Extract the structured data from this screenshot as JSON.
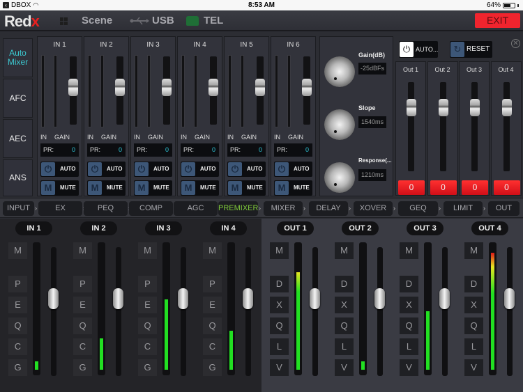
{
  "status_bar": {
    "carrier": "DBOX",
    "time": "8:53 AM",
    "battery": "64%",
    "battery_level": 0.64
  },
  "top_bar": {
    "logo_main": "Red",
    "logo_accent": "x",
    "scene": "Scene",
    "usb": "USB",
    "tel": "TEL",
    "exit": "EXIT"
  },
  "modes": [
    {
      "label": "Auto Mixer",
      "active": true
    },
    {
      "label": "AFC",
      "active": false
    },
    {
      "label": "AEC",
      "active": false
    },
    {
      "label": "ANS",
      "active": false
    }
  ],
  "input_strips": [
    {
      "title": "IN 1",
      "in_label": "IN",
      "gain_label": "GAIN",
      "pr_label": "PR:",
      "pr_value": "0",
      "auto": "AUTO",
      "mute": "MUTE",
      "gain_pos": 0.55
    },
    {
      "title": "IN 2",
      "in_label": "IN",
      "gain_label": "GAIN",
      "pr_label": "PR:",
      "pr_value": "0",
      "auto": "AUTO",
      "mute": "MUTE",
      "gain_pos": 0.55
    },
    {
      "title": "IN 3",
      "in_label": "IN",
      "gain_label": "GAIN",
      "pr_label": "PR:",
      "pr_value": "0",
      "auto": "AUTO",
      "mute": "MUTE",
      "gain_pos": 0.55
    },
    {
      "title": "IN 4",
      "in_label": "IN",
      "gain_label": "GAIN",
      "pr_label": "PR:",
      "pr_value": "0",
      "auto": "AUTO",
      "mute": "MUTE",
      "gain_pos": 0.55
    },
    {
      "title": "IN 5",
      "in_label": "IN",
      "gain_label": "GAIN",
      "pr_label": "PR:",
      "pr_value": "0",
      "auto": "AUTO",
      "mute": "MUTE",
      "gain_pos": 0.55
    },
    {
      "title": "IN 6",
      "in_label": "IN",
      "gain_label": "GAIN",
      "pr_label": "PR:",
      "pr_value": "0",
      "auto": "AUTO",
      "mute": "MUTE",
      "gain_pos": 0.55
    }
  ],
  "mute_glyph": "M",
  "auto_mixer": {
    "knobs": [
      {
        "label": "Gain(dB)",
        "value": "-25dBFs"
      },
      {
        "label": "Slope",
        "value": "1540ms"
      },
      {
        "label": "Response(...",
        "value": "1210ms"
      }
    ],
    "auto_button": "AUTO...",
    "reset_button": "RESET"
  },
  "outputs_top": [
    {
      "title": "Out 1",
      "value": "0",
      "fader_pos": 0.72
    },
    {
      "title": "Out 2",
      "value": "0",
      "fader_pos": 0.72
    },
    {
      "title": "Out 3",
      "value": "0",
      "fader_pos": 0.72
    },
    {
      "title": "Out 4",
      "value": "0",
      "fader_pos": 0.72
    }
  ],
  "chain": [
    {
      "label": "INPUT",
      "active": false
    },
    {
      "label": "EX",
      "active": false
    },
    {
      "label": "PEQ",
      "active": false
    },
    {
      "label": "COMP",
      "active": false
    },
    {
      "label": "AGC",
      "active": false
    },
    {
      "label": "PREMIXER",
      "active": true
    },
    {
      "label": "MIXER",
      "active": false
    },
    {
      "label": "DELAY",
      "active": false
    },
    {
      "label": "XOVER",
      "active": false
    },
    {
      "label": "GEQ",
      "active": false
    },
    {
      "label": "LIMIT",
      "active": false
    },
    {
      "label": "OUT",
      "active": false
    }
  ],
  "bottom_inputs": [
    {
      "title": "IN 1",
      "buttons": [
        "M",
        "P",
        "E",
        "Q",
        "C",
        "G"
      ],
      "level": 0.07,
      "fader_pos": 0.6
    },
    {
      "title": "IN 2",
      "buttons": [
        "M",
        "P",
        "E",
        "Q",
        "C",
        "G"
      ],
      "level": 0.26,
      "fader_pos": 0.6
    },
    {
      "title": "IN 3",
      "buttons": [
        "M",
        "P",
        "E",
        "Q",
        "C",
        "G"
      ],
      "level": 0.58,
      "fader_pos": 0.6
    },
    {
      "title": "IN 4",
      "buttons": [
        "M",
        "P",
        "E",
        "Q",
        "C",
        "G"
      ],
      "level": 0.32,
      "fader_pos": 0.6
    }
  ],
  "bottom_outputs": [
    {
      "title": "OUT 1",
      "buttons": [
        "M",
        "D",
        "X",
        "Q",
        "L",
        "V"
      ],
      "level": 0.8,
      "fader_pos": 0.6
    },
    {
      "title": "OUT 2",
      "buttons": [
        "M",
        "D",
        "X",
        "Q",
        "L",
        "V"
      ],
      "level": 0.07,
      "fader_pos": 0.6
    },
    {
      "title": "OUT 3",
      "buttons": [
        "M",
        "D",
        "X",
        "Q",
        "L",
        "V"
      ],
      "level": 0.48,
      "fader_pos": 0.6
    },
    {
      "title": "OUT 4",
      "buttons": [
        "M",
        "D",
        "X",
        "Q",
        "L",
        "V"
      ],
      "level": 0.96,
      "fader_pos": 0.6
    }
  ],
  "colors": {
    "accent_cyan": "#3cc8d0",
    "active_green": "#7ec83a",
    "exit_red": "#f0242e",
    "meter_green": "#22e022",
    "meter_yellow": "#e6e622",
    "meter_red": "#e01818"
  }
}
